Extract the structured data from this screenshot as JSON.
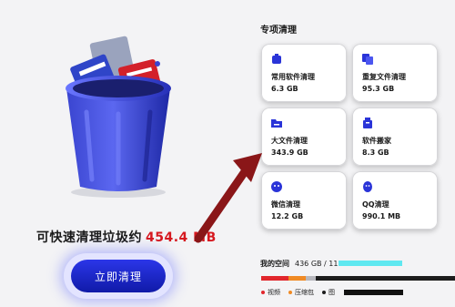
{
  "left": {
    "free_prefix": "可快速清理垃圾约",
    "free_amount": "454.4 MB",
    "clean_button": "立即清理"
  },
  "special": {
    "title": "专项清理",
    "cards": [
      {
        "name": "常用软件清理",
        "size": "6.3 GB",
        "icon": "software-icon"
      },
      {
        "name": "重复文件清理",
        "size": "95.3 GB",
        "icon": "duplicate-file-icon"
      },
      {
        "name": "大文件清理",
        "size": "343.9 GB",
        "icon": "folder-icon"
      },
      {
        "name": "软件搬家",
        "size": "8.3 GB",
        "icon": "move-icon"
      },
      {
        "name": "微信清理",
        "size": "12.2 GB",
        "icon": "wechat-icon"
      },
      {
        "name": "QQ清理",
        "size": "990.1 MB",
        "icon": "qq-icon"
      }
    ]
  },
  "storage": {
    "label": "我的空间",
    "value": "436 GB / 11",
    "legend": [
      {
        "label": "视频",
        "color": "#e1262c"
      },
      {
        "label": "压缩包",
        "color": "#f08a24"
      },
      {
        "label": "图",
        "color": "#1c1c1c"
      }
    ],
    "segments": [
      {
        "color": "#e1262c",
        "fraction": 0.14
      },
      {
        "color": "#f08a24",
        "fraction": 0.09
      },
      {
        "color": "#b7b7bd",
        "fraction": 0.05
      }
    ]
  },
  "colors": {
    "accent": "#1e28d6",
    "amount": "#d6181f"
  }
}
